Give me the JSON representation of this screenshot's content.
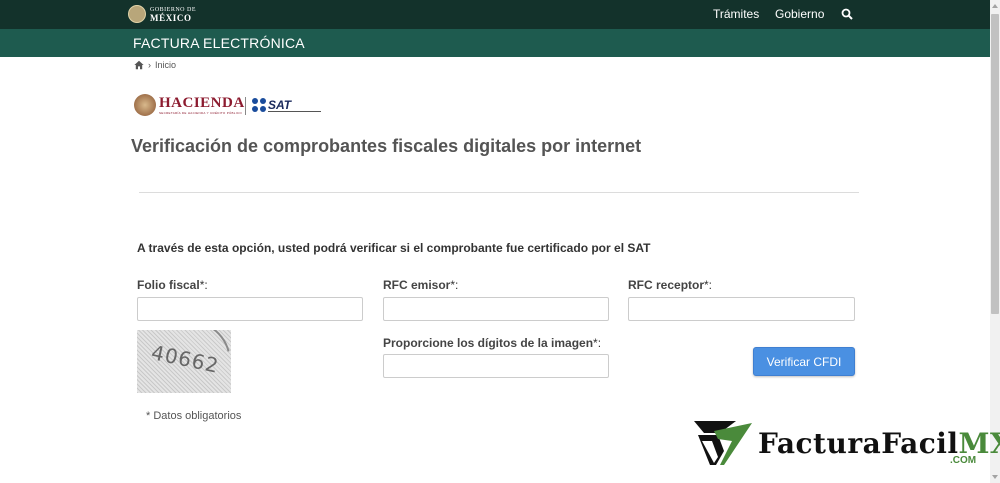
{
  "top_bar": {
    "gov_logo_small": "GOBIERNO DE",
    "gov_logo_big": "MÉXICO",
    "nav": [
      "Trámites",
      "Gobierno"
    ]
  },
  "sub_bar": {
    "title": "FACTURA ELECTRÓNICA"
  },
  "breadcrumb": {
    "separator": "›",
    "current": "Inicio"
  },
  "logos": {
    "hacienda": "HACIENDA",
    "hacienda_sub": "SECRETARÍA DE HACIENDA Y CRÉDITO PÚBLICO",
    "sat": "SAT"
  },
  "page": {
    "title": "Verificación de comprobantes fiscales digitales por internet",
    "intro": "A través de esta opción, usted podrá verificar si el comprobante fue certificado por el SAT"
  },
  "form": {
    "folio_label": "Folio fiscal",
    "rfc_emisor_label": "RFC emisor",
    "rfc_receptor_label": "RFC receptor",
    "captcha_label": "Proporcione los dígitos de la imagen",
    "required_mark": "*:",
    "captcha_text": "40662",
    "submit_label": "Verificar CFDI",
    "required_note": "* Datos obligatorios",
    "folio_value": "",
    "rfc_emisor_value": "",
    "rfc_receptor_value": "",
    "captcha_value": ""
  },
  "watermark": {
    "brand": "FacturaFacil",
    "brand_mx": "MX",
    "domain": ".COM"
  },
  "colors": {
    "top_bar": "#13322b",
    "sub_bar": "#1e5b4f",
    "button": "#4a90e2",
    "hacienda": "#8c1b2f",
    "brand_green": "#4a8a3b"
  }
}
